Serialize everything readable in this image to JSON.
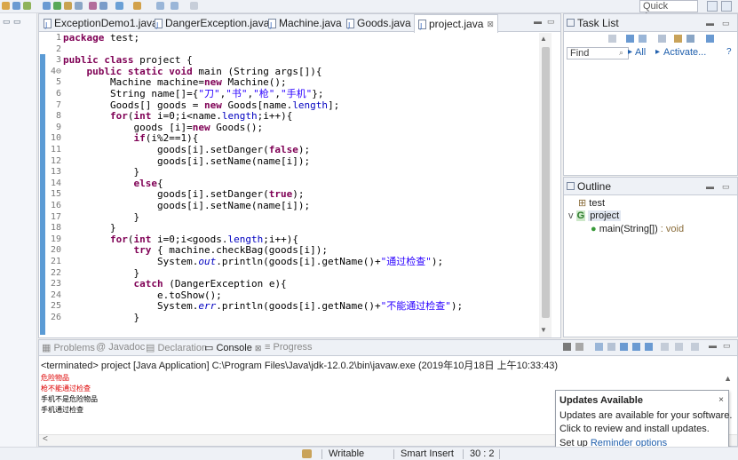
{
  "toolbar": {
    "quick_access_placeholder": "Quick Access"
  },
  "editor": {
    "tabs": [
      {
        "label": "ExceptionDemo1.java",
        "active": false
      },
      {
        "label": "DangerException.java",
        "active": false
      },
      {
        "label": "Machine.java",
        "active": false
      },
      {
        "label": "Goods.java",
        "active": false
      },
      {
        "label": "project.java",
        "active": true
      }
    ],
    "line_numbers": [
      "1",
      "2",
      "3",
      "4⊖",
      "5",
      "6",
      "7",
      "8",
      "9",
      "10",
      "11",
      "12",
      "13",
      "14",
      "15",
      "16",
      "17",
      "18",
      "19",
      "20",
      "21",
      "22",
      "23",
      "24",
      "25",
      "26"
    ]
  },
  "task_list": {
    "title": "Task List",
    "find_placeholder": "Find",
    "all_label": "All",
    "activate_label": "Activate..."
  },
  "outline": {
    "title": "Outline",
    "items": [
      {
        "label": "test"
      },
      {
        "label": "project"
      },
      {
        "label": "main(String[])",
        "suffix": " : void"
      }
    ]
  },
  "console": {
    "tabs": [
      "Problems",
      "Javadoc",
      "Declaration",
      "Console",
      "Progress"
    ],
    "terminated_line": "<terminated> project [Java Application] C:\\Program Files\\Java\\jdk-12.0.2\\bin\\javaw.exe (2019年10月18日 上午10:33:43)",
    "output": [
      {
        "text": "危险物品",
        "type": "err"
      },
      {
        "text": "枪不能通过检查",
        "type": "err"
      },
      {
        "text": "手机不是危险物品",
        "type": "out"
      },
      {
        "text": "手机通过检查",
        "type": "out"
      }
    ]
  },
  "updates_popup": {
    "title": "Updates Available",
    "close": "×",
    "line1": "Updates are available for your software.",
    "line2": "Click to review and install updates.",
    "line3_prefix": "Set up ",
    "line3_link": "Reminder options"
  },
  "statusbar": {
    "writable": "Writable",
    "insert_mode": "Smart Insert",
    "position": "30 : 2"
  },
  "code_lines": [
    "package test;",
    "",
    "public class project {",
    "    public static void main (String args[]){",
    "        Machine machine=new Machine();",
    "        String name[]={\"刀\",\"书\",\"枪\",\"手机\"};",
    "        Goods[] goods = new Goods[name.length];",
    "        for(int i=0;i<name.length;i++){",
    "            goods [i]=new Goods();",
    "            if(i%2==1){",
    "                goods[i].setDanger(false);",
    "                goods[i].setName(name[i]);",
    "            }",
    "            else{",
    "                goods[i].setDanger(true);",
    "                goods[i].setName(name[i]);",
    "            }",
    "        }",
    "        for(int i=0;i<goods.length;i++){",
    "            try { machine.checkBag(goods[i]);",
    "                System.out.println(goods[i].getName()+\"通过检查\");",
    "            }",
    "            catch (DangerException e){",
    "                e.toShow();",
    "                System.err.println(goods[i].getName()+\"不能通过检查\");",
    "            }"
  ]
}
